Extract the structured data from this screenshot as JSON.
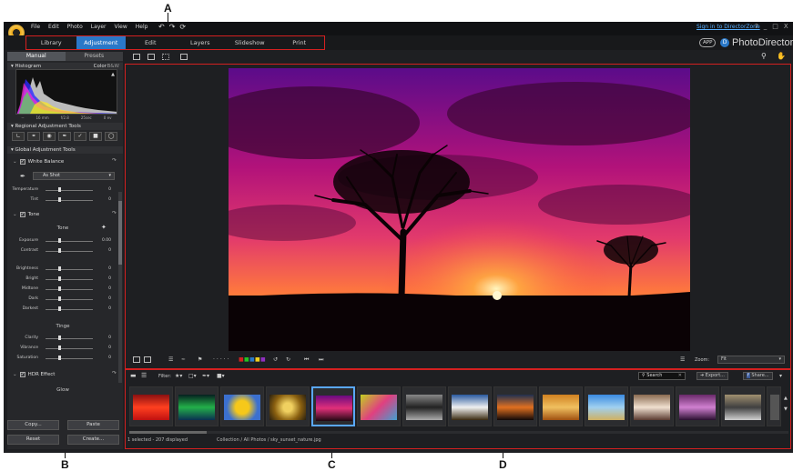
{
  "callouts": {
    "a": "A",
    "b": "B",
    "c": "C",
    "d": "D"
  },
  "menubar": {
    "items": [
      "File",
      "Edit",
      "Photo",
      "Layer",
      "View",
      "Help"
    ],
    "sign_in": "Sign in to DirectorZone",
    "window_controls": [
      "?",
      "_",
      "□",
      "X"
    ]
  },
  "modes": {
    "items": [
      "Library",
      "Adjustment",
      "Edit",
      "Layers",
      "Slideshow",
      "Print"
    ],
    "active": "Adjustment"
  },
  "brand": {
    "app_badge": "APP",
    "d_badge": "D",
    "name": "PhotoDirector"
  },
  "left_panel": {
    "tabs": [
      "Manual",
      "Presets"
    ],
    "histogram": {
      "title": "Histogram",
      "color_label": "Color",
      "bw_label": "B&W",
      "info": [
        "--",
        "16 mm",
        "f/2.8",
        "25sec",
        "0 ev"
      ]
    },
    "regional": {
      "title": "Regional Adjustment Tools"
    },
    "global": {
      "title": "Global Adjustment Tools"
    },
    "white_balance": {
      "title": "White Balance",
      "preset": "As Shot",
      "sliders": [
        {
          "label": "Temperature",
          "value": "0"
        },
        {
          "label": "Tint",
          "value": "0"
        }
      ]
    },
    "tone": {
      "title": "Tone",
      "tone_label": "Tone",
      "sliders_a": [
        {
          "label": "Exposure",
          "value": "0.00"
        },
        {
          "label": "Contrast",
          "value": "0"
        }
      ],
      "sliders_b": [
        {
          "label": "Brightness",
          "value": "0"
        },
        {
          "label": "Bright",
          "value": "0"
        },
        {
          "label": "Midtone",
          "value": "0"
        },
        {
          "label": "Dark",
          "value": "0"
        },
        {
          "label": "Darkest",
          "value": "0"
        }
      ],
      "tinge_label": "Tinge",
      "sliders_c": [
        {
          "label": "Clarity",
          "value": "0"
        },
        {
          "label": "Vibrance",
          "value": "0"
        },
        {
          "label": "Saturation",
          "value": "0"
        }
      ]
    },
    "hdr": {
      "title": "HDR Effect",
      "glow_label": "Glow"
    },
    "buttons": {
      "copy": "Copy...",
      "paste": "Paste",
      "reset": "Reset",
      "create": "Create..."
    }
  },
  "viewer": {
    "zoom_label": "Zoom:",
    "zoom_value": "Fit"
  },
  "filmstrip": {
    "filter_label": "Filter:",
    "search_placeholder": "Search",
    "export_label": "Export...",
    "share_label": "Share...",
    "status_count": "1 selected - 207 displayed",
    "status_path": "Collection / All Photos / sky_sunset_nature.jpg"
  }
}
